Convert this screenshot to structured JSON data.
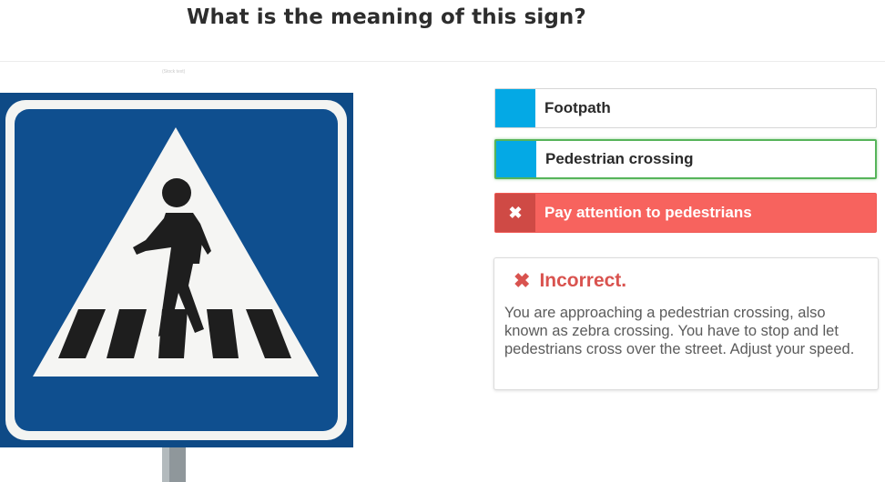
{
  "question": "What is the meaning of this sign?",
  "image_credit": "(Stock text)",
  "sign": {
    "icon": "pedestrian-crossing-sign",
    "colors": {
      "blue": "#0d4f8f",
      "white": "#ffffff",
      "figure": "#1f1f1f"
    }
  },
  "answers": [
    {
      "label": "Footpath",
      "state": "neutral",
      "marker_icon": ""
    },
    {
      "label": "Pedestrian crossing",
      "state": "correct",
      "marker_icon": ""
    },
    {
      "label": "Pay attention to pedestrians",
      "state": "incorrect",
      "marker_icon": "✖"
    }
  ],
  "feedback": {
    "icon": "✖",
    "title": "Incorrect.",
    "text": "You are approaching a pedestrian crossing, also known as zebra crossing. You have to stop and let pedestrians cross over the street. Adjust your speed."
  },
  "colors": {
    "accent_blue": "#04a9e5",
    "correct_green": "#56b45a",
    "incorrect_red": "#f7635e",
    "error_text": "#d9534f"
  }
}
